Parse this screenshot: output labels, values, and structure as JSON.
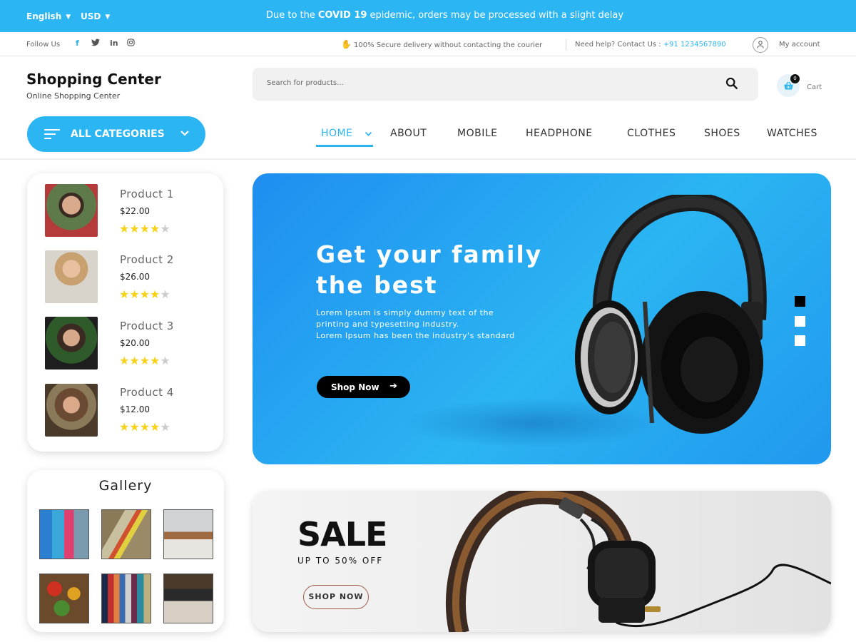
{
  "topbar": {
    "language": "English",
    "currency": "USD",
    "notice_pre": "Due to the",
    "notice_bold": "COVID 19",
    "notice_post": "epidemic, orders may be processed with a slight delay"
  },
  "infobar": {
    "follow": "Follow Us",
    "social": [
      "f",
      "twitter",
      "in",
      "instagram"
    ],
    "secure": "100% Secure delivery without contacting the courier",
    "help_label": "Need help? Contact Us :",
    "help_phone": "+91 1234567890",
    "account": "My account"
  },
  "header": {
    "brand": "Shopping Center",
    "tagline": "Online Shopping Center",
    "search_placeholder": "Search for products...",
    "cart_count": "0",
    "cart_label": "Cart"
  },
  "nav": {
    "all_categories": "ALL CATEGORIES",
    "items": [
      "HOME",
      "ABOUT",
      "MOBILE",
      "HEADPHONE",
      "CLOTHES",
      "SHOES",
      "WATCHES"
    ],
    "active": "HOME"
  },
  "products": [
    {
      "name": "Product 1",
      "price": "$22.00",
      "rating": 4,
      "max": 5
    },
    {
      "name": "Product 2",
      "price": "$26.00",
      "rating": 4,
      "max": 5
    },
    {
      "name": "Product 3",
      "price": "$20.00",
      "rating": 4,
      "max": 5
    },
    {
      "name": "Product 4",
      "price": "$12.00",
      "rating": 4,
      "max": 5
    }
  ],
  "gallery": {
    "title": "Gallery",
    "images": [
      "luggage",
      "food-tray",
      "dining-room",
      "vegetables",
      "clothes-rack",
      "desk-workspace"
    ]
  },
  "hero": {
    "title_line1": "Get your family",
    "title_line2": "the best",
    "desc_line1": "Lorem Ipsum is simply dummy text of the",
    "desc_line2": "printing and typesetting industry.",
    "desc_line3": "Lorem Ipsum has been the industry's standard",
    "button": "Shop Now",
    "slides": 3,
    "active_slide": 1
  },
  "sale": {
    "title": "SALE",
    "subtitle": "UP TO 50% OFF",
    "button": "SHOP NOW"
  },
  "colors": {
    "accent": "#2bb5f2",
    "star": "#f7d21b"
  }
}
